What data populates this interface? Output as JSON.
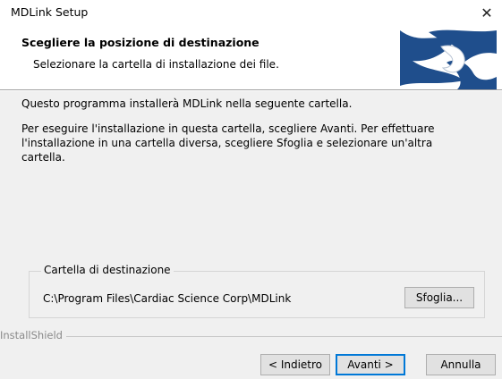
{
  "window": {
    "title": "MDLink Setup",
    "close_symbol": "✕"
  },
  "header": {
    "title": "Scegliere la posizione di destinazione",
    "subtitle": "Selezionare la cartella di installazione dei file.",
    "logo_icon": "installshield-logo-icon"
  },
  "body": {
    "line1": "Questo programma installerà MDLink nella seguente cartella.",
    "line2": "Per eseguire l'installazione in questa cartella, scegliere Avanti. Per effettuare",
    "line3": "l'installazione in una cartella diversa, scegliere Sfoglia e selezionare un'altra cartella."
  },
  "destination": {
    "group_label": "Cartella di destinazione",
    "path": "C:\\Program Files\\Cardiac Science Corp\\MDLink",
    "browse_label": "Sfoglia..."
  },
  "footer": {
    "brand": "InstallShield",
    "back_label": "< Indietro",
    "next_label": "Avanti >",
    "cancel_label": "Annulla"
  },
  "colors": {
    "accent": "#0078d7",
    "logo_blue": "#1f4e8c"
  }
}
